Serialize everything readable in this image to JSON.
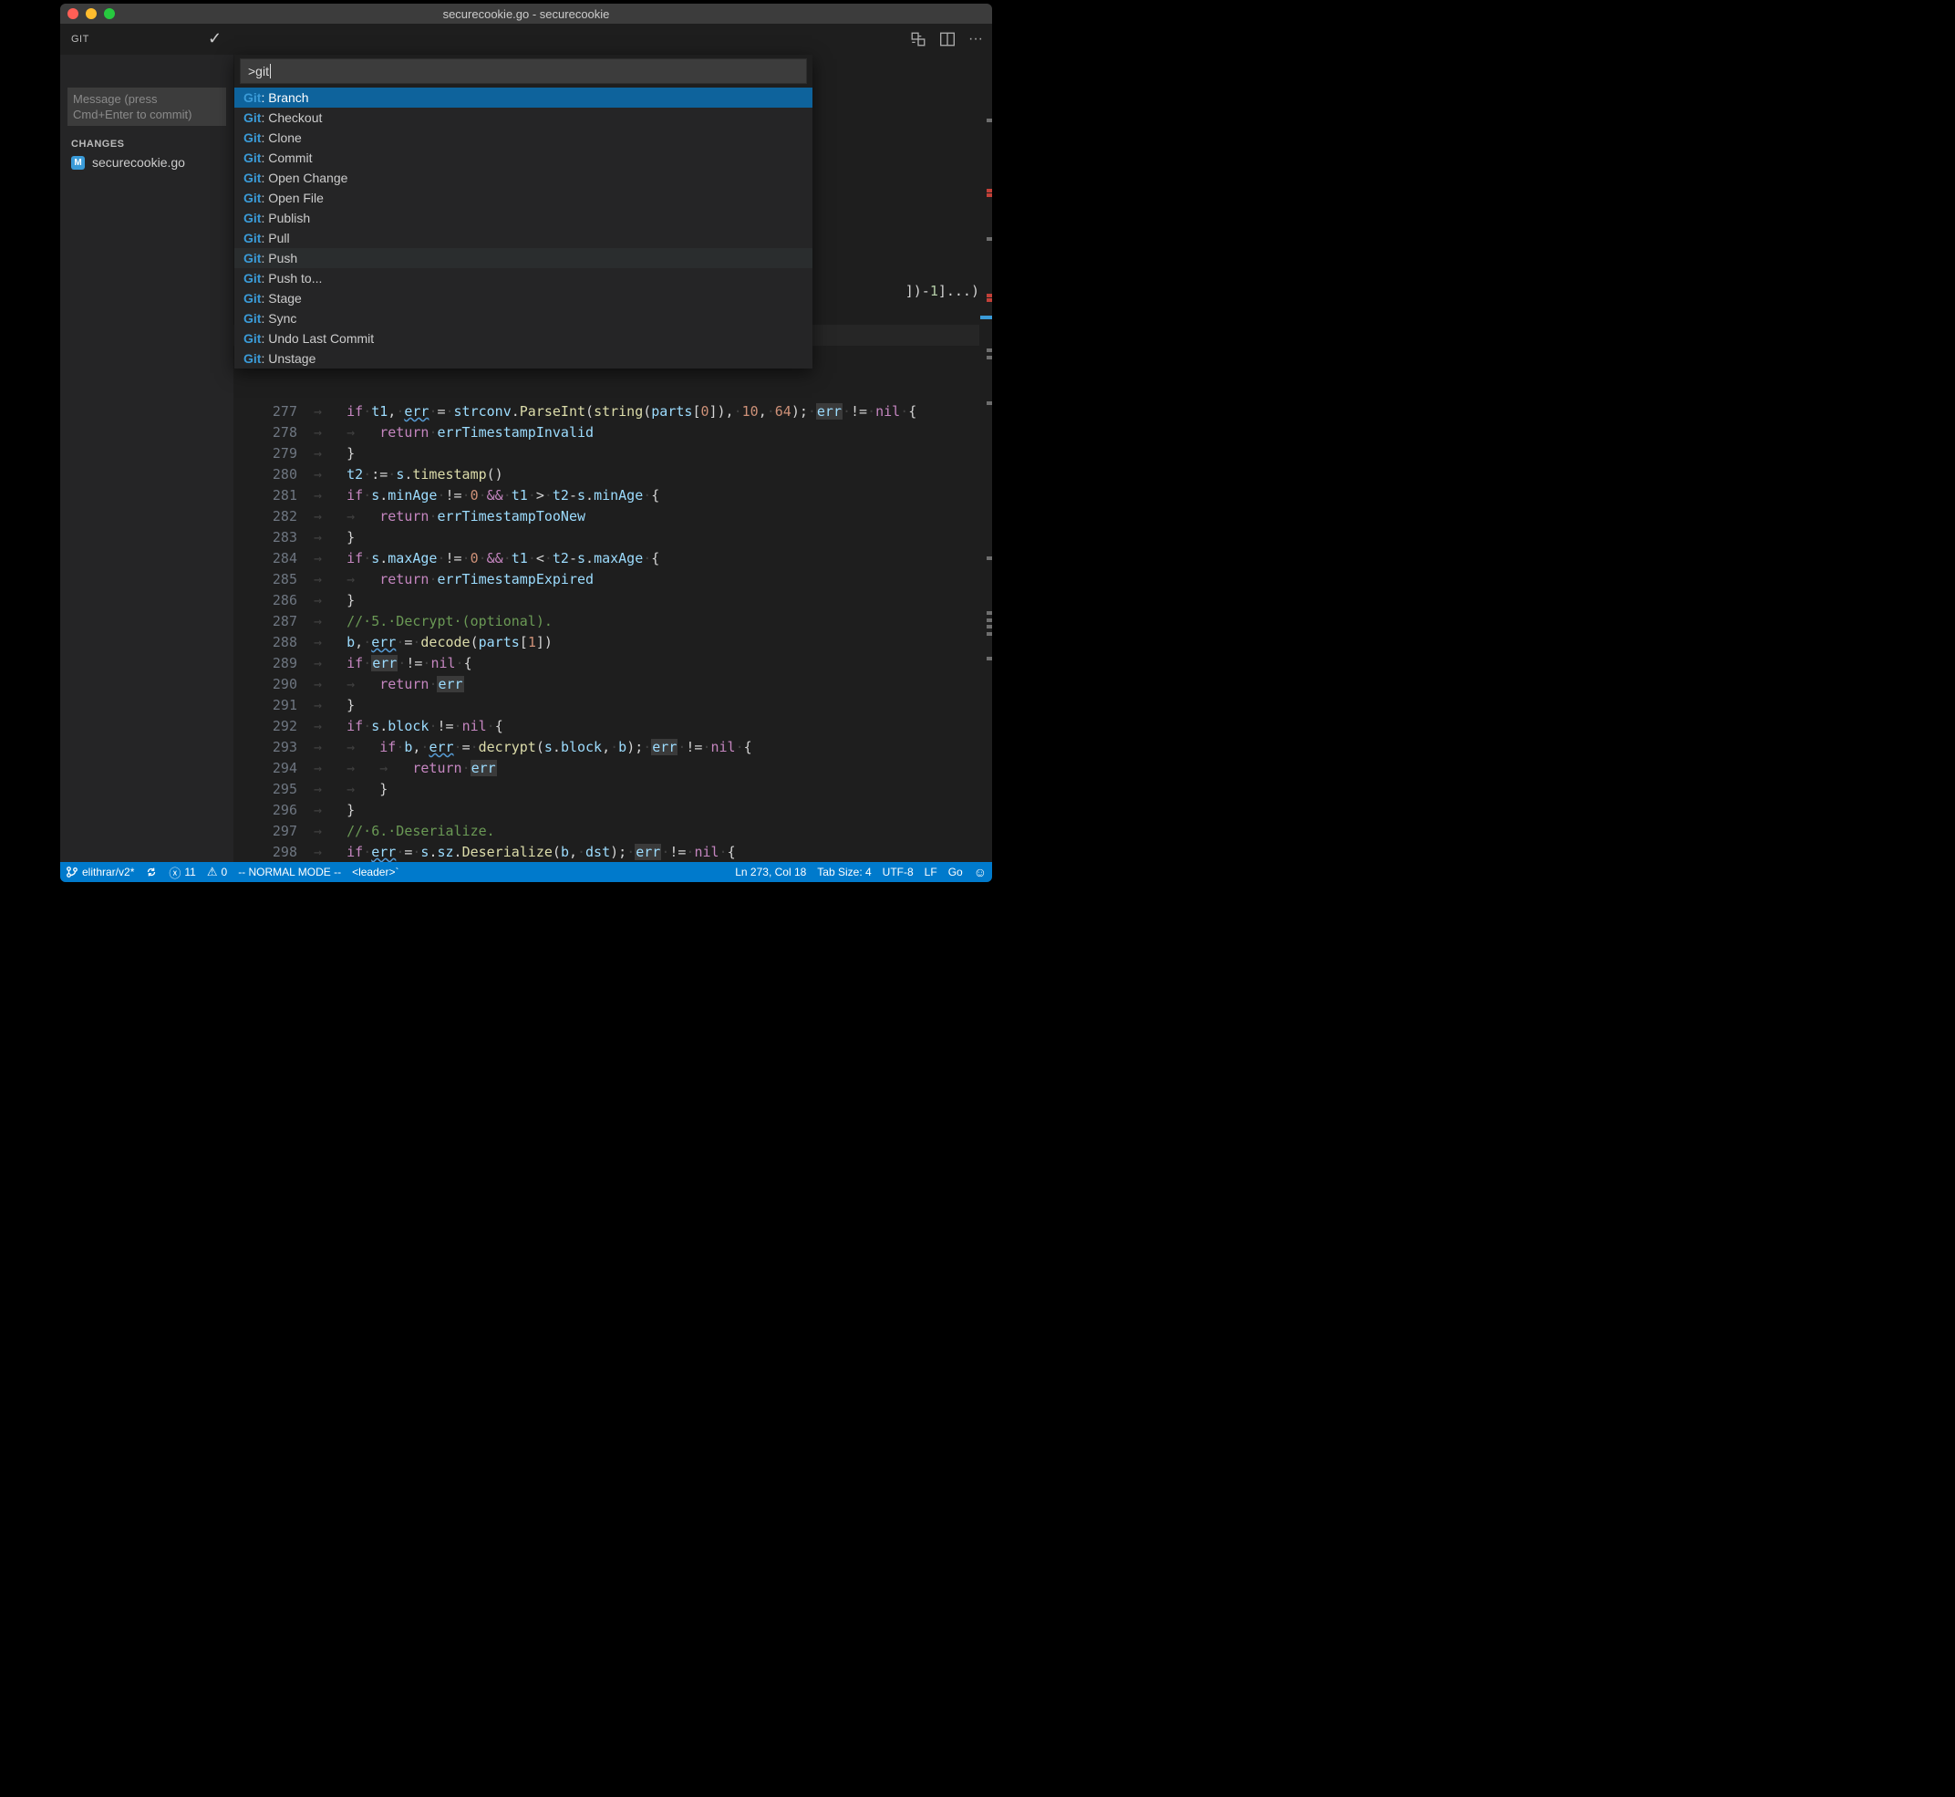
{
  "titlebar": {
    "title": "securecookie.go - securecookie"
  },
  "sidebar": {
    "title": "GIT",
    "message_placeholder": "Message (press Cmd+Enter to commit)",
    "section": "CHANGES",
    "file_badge": "M",
    "file_name": "securecookie.go"
  },
  "palette": {
    "input": ">git",
    "items": [
      {
        "prefix": "Git",
        "label": ": Branch"
      },
      {
        "prefix": "Git",
        "label": ": Checkout"
      },
      {
        "prefix": "Git",
        "label": ": Clone"
      },
      {
        "prefix": "Git",
        "label": ": Commit"
      },
      {
        "prefix": "Git",
        "label": ": Open Change"
      },
      {
        "prefix": "Git",
        "label": ": Open File"
      },
      {
        "prefix": "Git",
        "label": ": Publish"
      },
      {
        "prefix": "Git",
        "label": ": Pull"
      },
      {
        "prefix": "Git",
        "label": ": Push"
      },
      {
        "prefix": "Git",
        "label": ": Push to..."
      },
      {
        "prefix": "Git",
        "label": ": Stage"
      },
      {
        "prefix": "Git",
        "label": ": Sync"
      },
      {
        "prefix": "Git",
        "label": ": Undo Last Commit"
      },
      {
        "prefix": "Git",
        "label": ": Unstage"
      }
    ],
    "selected_index": 0,
    "hover_index": 8
  },
  "editor": {
    "top_fragment": "])-1]...)",
    "lines": [
      {
        "no": 277,
        "ind": "→   ",
        "html": "<span class='k'>if</span><span class='ws'>·</span><span class='n'>t1</span>,<span class='ws'>·</span><span class='n wavy'>err</span><span class='ws'>·</span>=<span class='ws'>·</span><span class='n'>strconv</span>.<span class='f'>ParseInt</span>(<span class='f'>string</span>(<span class='n'>parts</span>[<span class='s'>0</span>]),<span class='ws'>·</span><span class='s'>10</span>,<span class='ws'>·</span><span class='s'>64</span>);<span class='ws'>·</span><span class='n err-hl'>err</span><span class='ws'>·</span>!=<span class='ws'>·</span><span class='k'>nil</span><span class='ws'>·</span>{"
      },
      {
        "no": 278,
        "ind": "→   →   ",
        "html": "<span class='k'>return</span><span class='ws'>·</span><span class='n'>errTimestampInvalid</span>"
      },
      {
        "no": 279,
        "ind": "→   ",
        "html": "}"
      },
      {
        "no": 280,
        "ind": "→   ",
        "html": "<span class='n'>t2</span><span class='ws'>·</span>:=<span class='ws'>·</span><span class='n'>s</span>.<span class='f'>timestamp</span>()"
      },
      {
        "no": 281,
        "ind": "→   ",
        "html": "<span class='k'>if</span><span class='ws'>·</span><span class='n'>s</span>.<span class='n'>minAge</span><span class='ws'>·</span>!=<span class='ws'>·</span><span class='s'>0</span><span class='ws'>·</span><span class='k'>&amp;&amp;</span><span class='ws'>·</span><span class='n'>t1</span><span class='ws'>·</span>&gt;<span class='ws'>·</span><span class='n'>t2</span>-<span class='n'>s</span>.<span class='n'>minAge</span><span class='ws'>·</span>{"
      },
      {
        "no": 282,
        "ind": "→   →   ",
        "html": "<span class='k'>return</span><span class='ws'>·</span><span class='n'>errTimestampTooNew</span>"
      },
      {
        "no": 283,
        "ind": "→   ",
        "html": "}"
      },
      {
        "no": 284,
        "ind": "→   ",
        "html": "<span class='k'>if</span><span class='ws'>·</span><span class='n'>s</span>.<span class='n'>maxAge</span><span class='ws'>·</span>!=<span class='ws'>·</span><span class='s'>0</span><span class='ws'>·</span><span class='k'>&amp;&amp;</span><span class='ws'>·</span><span class='n'>t1</span><span class='ws'>·</span>&lt;<span class='ws'>·</span><span class='n'>t2</span>-<span class='n'>s</span>.<span class='n'>maxAge</span><span class='ws'>·</span>{"
      },
      {
        "no": 285,
        "ind": "→   →   ",
        "html": "<span class='k'>return</span><span class='ws'>·</span><span class='n'>errTimestampExpired</span>"
      },
      {
        "no": 286,
        "ind": "→   ",
        "html": "}"
      },
      {
        "no": 287,
        "ind": "→   ",
        "html": "<span class='c'>//·5.·Decrypt·(optional).</span>"
      },
      {
        "no": 288,
        "ind": "→   ",
        "html": "<span class='n'>b</span>,<span class='ws'>·</span><span class='n wavy'>err</span><span class='ws'>·</span>=<span class='ws'>·</span><span class='f'>decode</span>(<span class='n'>parts</span>[<span class='s'>1</span>])"
      },
      {
        "no": 289,
        "ind": "→   ",
        "html": "<span class='k'>if</span><span class='ws'>·</span><span class='n err-hl'>err</span><span class='ws'>·</span>!=<span class='ws'>·</span><span class='k'>nil</span><span class='ws'>·</span>{"
      },
      {
        "no": 290,
        "ind": "→   →   ",
        "html": "<span class='k'>return</span><span class='ws'>·</span><span class='n err-hl'>err</span>"
      },
      {
        "no": 291,
        "ind": "→   ",
        "html": "}"
      },
      {
        "no": 292,
        "ind": "→   ",
        "html": "<span class='k'>if</span><span class='ws'>·</span><span class='n'>s</span>.<span class='n'>block</span><span class='ws'>·</span>!=<span class='ws'>·</span><span class='k'>nil</span><span class='ws'>·</span>{"
      },
      {
        "no": 293,
        "ind": "→   →   ",
        "html": "<span class='k'>if</span><span class='ws'>·</span><span class='n'>b</span>,<span class='ws'>·</span><span class='n wavy'>err</span><span class='ws'>·</span>=<span class='ws'>·</span><span class='f'>decrypt</span>(<span class='n'>s</span>.<span class='n'>block</span>,<span class='ws'>·</span><span class='n'>b</span>);<span class='ws'>·</span><span class='n err-hl'>err</span><span class='ws'>·</span>!=<span class='ws'>·</span><span class='k'>nil</span><span class='ws'>·</span>{"
      },
      {
        "no": 294,
        "ind": "→   →   →   ",
        "html": "<span class='k'>return</span><span class='ws'>·</span><span class='n err-hl'>err</span>"
      },
      {
        "no": 295,
        "ind": "→   →   ",
        "html": "}"
      },
      {
        "no": 296,
        "ind": "→   ",
        "html": "}"
      },
      {
        "no": 297,
        "ind": "→   ",
        "html": "<span class='c'>//·6.·Deserialize.</span>"
      },
      {
        "no": 298,
        "ind": "→   ",
        "html": "<span class='k'>if</span><span class='ws'>·</span><span class='n wavy'>err</span><span class='ws'>·</span>=<span class='ws'>·</span><span class='n'>s</span>.<span class='n'>sz</span>.<span class='f'>Deserialize</span>(<span class='n'>b</span>,<span class='ws'>·</span><span class='n'>dst</span>);<span class='ws'>·</span><span class='n err-hl'>err</span><span class='ws'>·</span>!=<span class='ws'>·</span><span class='k'>nil</span><span class='ws'>·</span>{"
      }
    ]
  },
  "status": {
    "branch": "elithrar/v2*",
    "errors": "11",
    "warnings": "0",
    "mode": "-- NORMAL MODE --",
    "leader": "<leader>`",
    "pos": "Ln 273, Col 18",
    "tabsize": "Tab Size: 4",
    "encoding": "UTF-8",
    "eol": "LF",
    "lang": "Go"
  }
}
